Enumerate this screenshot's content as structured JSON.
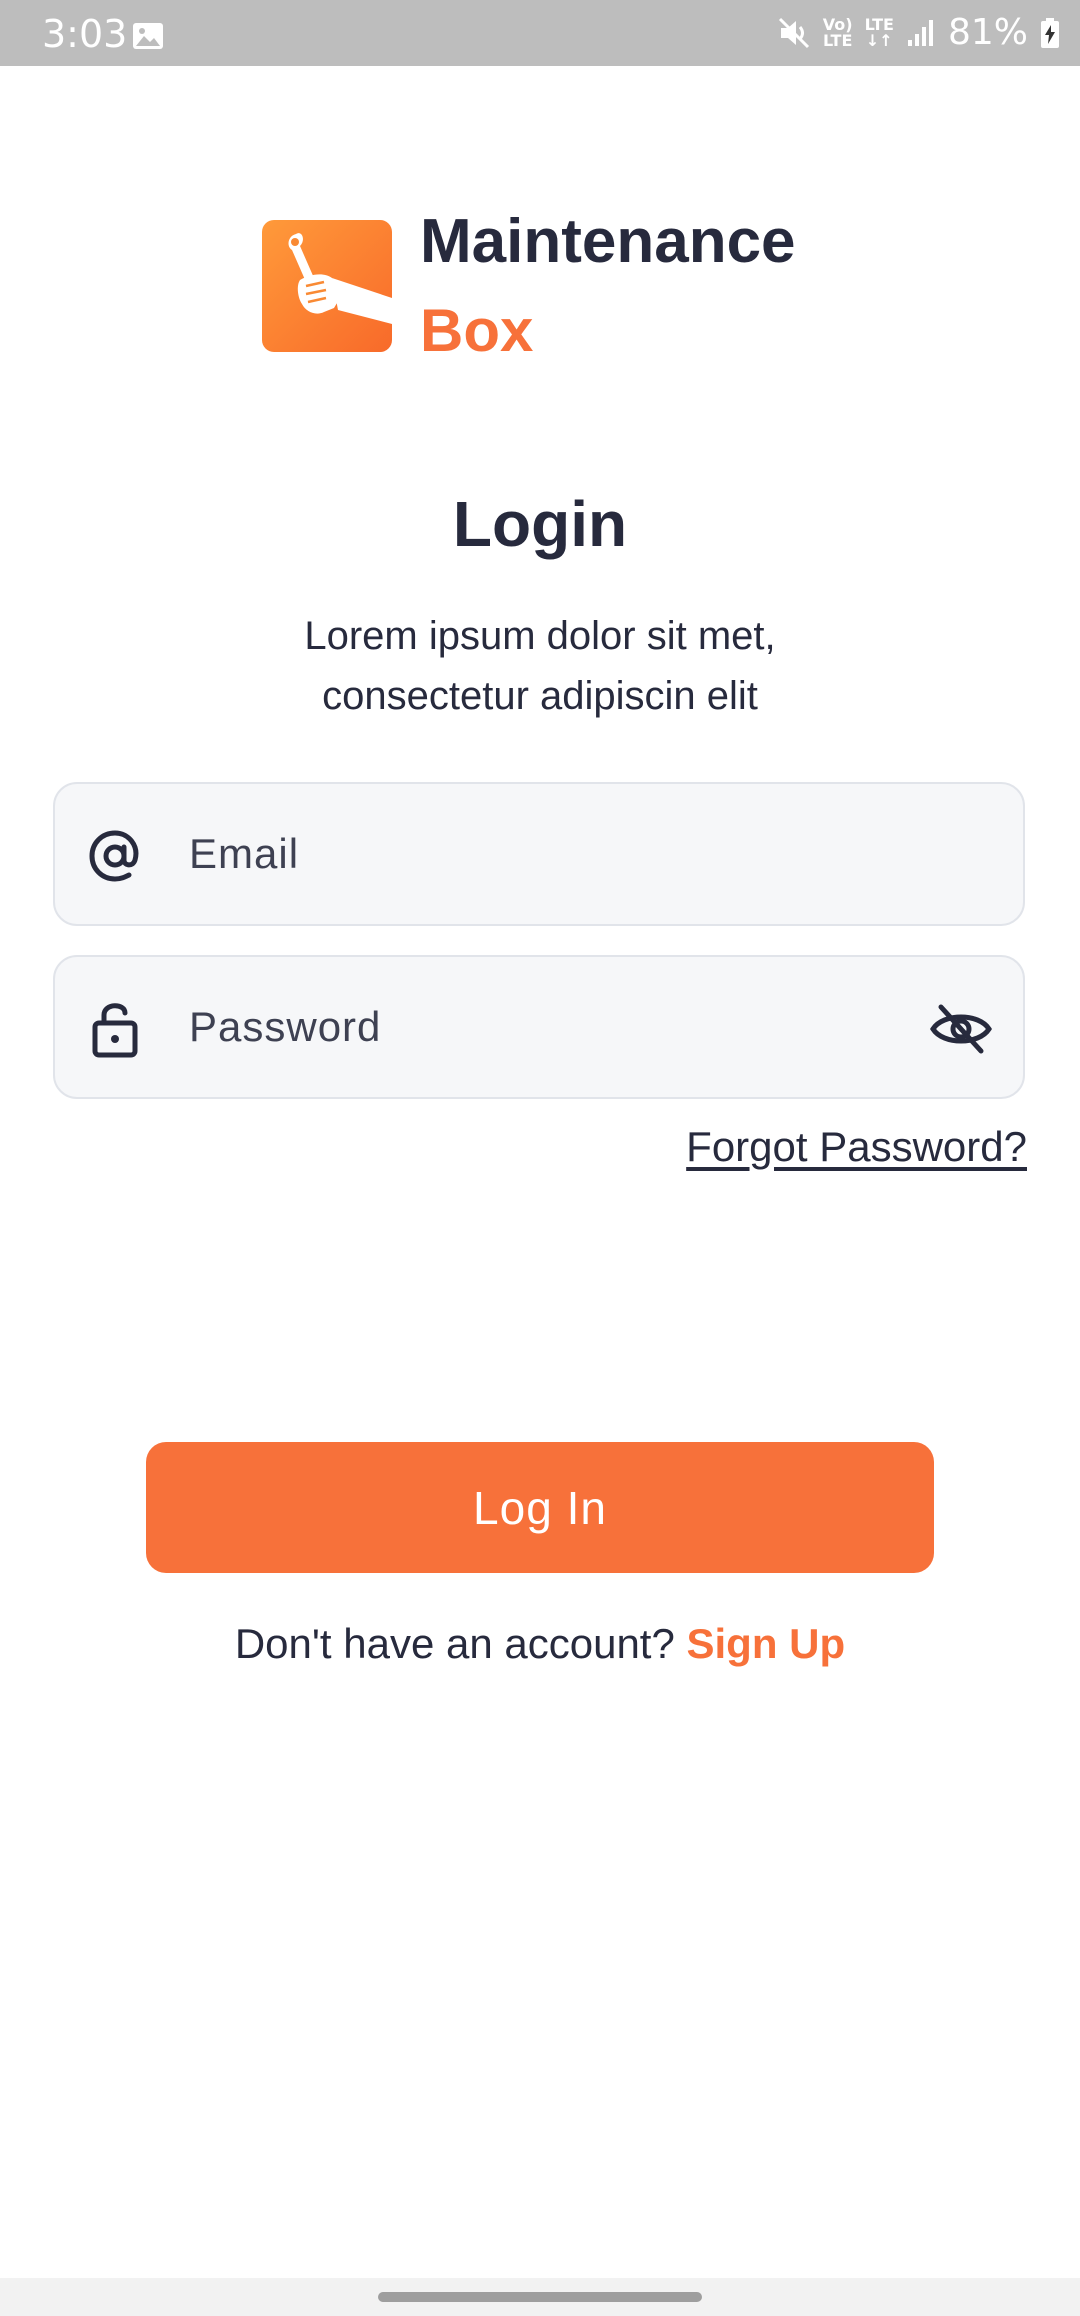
{
  "status_bar": {
    "time": "3:03",
    "volte_top": "Vo)",
    "volte_bottom": "LTE",
    "lte_label": "LTE",
    "battery": "81%",
    "icons": [
      "gallery-icon",
      "mute-icon",
      "signal-icon",
      "battery-charging-icon"
    ]
  },
  "app": {
    "name_line1": "Maintenance",
    "name_line2": "Box",
    "accent_color": "#f7713a",
    "text_color": "#272a3d"
  },
  "login": {
    "heading": "Login",
    "subtitle_line1": "Lorem ipsum dolor sit met,",
    "subtitle_line2": "consectetur adipiscin elit",
    "email": {
      "placeholder": "Email",
      "value": "",
      "icon": "at-icon"
    },
    "password": {
      "placeholder": "Password",
      "value": "",
      "icon": "lock-icon",
      "toggle_icon": "eye-off-icon"
    },
    "forgot_label": "Forgot Password?",
    "button_label": "Log In",
    "signup_prompt": "Don't have an account?",
    "signup_label": "Sign Up"
  }
}
